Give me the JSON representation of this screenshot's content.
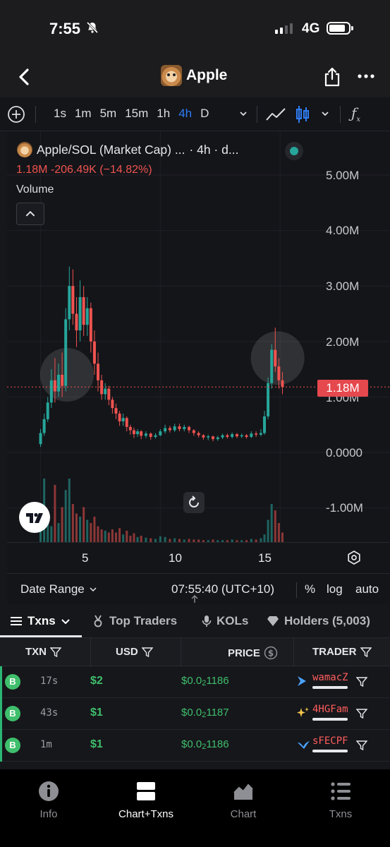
{
  "status": {
    "time": "7:55",
    "network": "4G"
  },
  "header": {
    "title": "Apple"
  },
  "toolbar": {
    "intervals": [
      "1s",
      "1m",
      "5m",
      "15m",
      "1h",
      "4h",
      "D"
    ],
    "active_interval": "4h"
  },
  "chart": {
    "symbol": "Apple/SOL (Market Cap) ...",
    "interval_text": "· 4h · d...",
    "change_text": "1.18M  -206.49K (−14.82%)",
    "volume_label": "Volume",
    "price_tag": "1.18M",
    "y_axis": [
      "5.00M",
      "4.00M",
      "3.00M",
      "2.00M",
      "1.00M",
      "0.0000",
      "-1.00M"
    ],
    "x_axis": [
      "5",
      "10",
      "15"
    ]
  },
  "range_bar": {
    "date_range": "Date Range",
    "clock": "07:55:40 (UTC+10)",
    "percent": "%",
    "log": "log",
    "auto": "auto"
  },
  "tabs": {
    "txns": "Txns",
    "top_traders": "Top Traders",
    "kols": "KOLs",
    "holders": "Holders (5,003)"
  },
  "table": {
    "headers": {
      "txn": "TXN",
      "usd": "USD",
      "price": "PRICE",
      "trader": "TRADER"
    },
    "rows": [
      {
        "type": "B",
        "age": "17s",
        "usd": "$2",
        "price_main": "$0.0",
        "price_sub": "2",
        "price_tail": "1186",
        "trader": "wamacZ"
      },
      {
        "type": "B",
        "age": "43s",
        "usd": "$1",
        "price_main": "$0.0",
        "price_sub": "2",
        "price_tail": "1187",
        "trader": "4HGFam"
      },
      {
        "type": "B",
        "age": "1m",
        "usd": "$1",
        "price_main": "$0.0",
        "price_sub": "2",
        "price_tail": "1186",
        "trader": "sFECPF"
      }
    ]
  },
  "bottom_nav": {
    "info": "Info",
    "chart_txns": "Chart+Txns",
    "chart": "Chart",
    "txns": "Txns"
  },
  "colors": {
    "up": "#26a69a",
    "down": "#ef5350",
    "accent": "#2f7df6",
    "buy_green": "#3fbf6c"
  },
  "chart_data": {
    "type": "candlestick",
    "x_range": [
      3.6,
      16.5
    ],
    "ylim": [
      -1500000,
      5500000
    ],
    "price_line": 1180000,
    "candles": [
      {
        "x": 5.0,
        "o": 150000,
        "c": 350000,
        "h": 420000,
        "l": 100000
      },
      {
        "x": 5.15,
        "o": 350000,
        "c": 600000,
        "h": 700000,
        "l": 300000
      },
      {
        "x": 5.3,
        "o": 600000,
        "c": 900000,
        "h": 1000000,
        "l": 550000
      },
      {
        "x": 5.45,
        "o": 900000,
        "c": 1300000,
        "h": 1500000,
        "l": 800000
      },
      {
        "x": 5.6,
        "o": 1300000,
        "c": 1100000,
        "h": 1700000,
        "l": 900000
      },
      {
        "x": 5.75,
        "o": 1100000,
        "c": 1400000,
        "h": 1600000,
        "l": 1000000
      },
      {
        "x": 5.9,
        "o": 1400000,
        "c": 1200000,
        "h": 1800000,
        "l": 1000000
      },
      {
        "x": 6.05,
        "o": 1200000,
        "c": 2400000,
        "h": 2600000,
        "l": 1100000
      },
      {
        "x": 6.2,
        "o": 2400000,
        "c": 3000000,
        "h": 3350000,
        "l": 2200000
      },
      {
        "x": 6.35,
        "o": 3000000,
        "c": 2500000,
        "h": 3300000,
        "l": 2300000
      },
      {
        "x": 6.5,
        "o": 2500000,
        "c": 2200000,
        "h": 2800000,
        "l": 1900000
      },
      {
        "x": 6.65,
        "o": 2200000,
        "c": 2800000,
        "h": 3100000,
        "l": 2000000
      },
      {
        "x": 6.8,
        "o": 2800000,
        "c": 2300000,
        "h": 3000000,
        "l": 2100000
      },
      {
        "x": 6.95,
        "o": 2300000,
        "c": 2600000,
        "h": 2800000,
        "l": 2100000
      },
      {
        "x": 7.1,
        "o": 2600000,
        "c": 2000000,
        "h": 2700000,
        "l": 1800000
      },
      {
        "x": 7.25,
        "o": 2000000,
        "c": 1600000,
        "h": 2200000,
        "l": 1400000
      },
      {
        "x": 7.4,
        "o": 1600000,
        "c": 1300000,
        "h": 1800000,
        "l": 1100000
      },
      {
        "x": 7.55,
        "o": 1300000,
        "c": 1050000,
        "h": 1400000,
        "l": 950000
      },
      {
        "x": 7.7,
        "o": 1050000,
        "c": 1150000,
        "h": 1250000,
        "l": 950000
      },
      {
        "x": 7.85,
        "o": 1150000,
        "c": 950000,
        "h": 1200000,
        "l": 850000
      },
      {
        "x": 8.0,
        "o": 950000,
        "c": 800000,
        "h": 1000000,
        "l": 700000
      },
      {
        "x": 8.15,
        "o": 800000,
        "c": 700000,
        "h": 880000,
        "l": 600000
      },
      {
        "x": 8.3,
        "o": 700000,
        "c": 560000,
        "h": 750000,
        "l": 480000
      },
      {
        "x": 8.45,
        "o": 560000,
        "c": 620000,
        "h": 700000,
        "l": 480000
      },
      {
        "x": 8.6,
        "o": 620000,
        "c": 460000,
        "h": 650000,
        "l": 380000
      },
      {
        "x": 8.75,
        "o": 460000,
        "c": 400000,
        "h": 500000,
        "l": 320000
      },
      {
        "x": 8.9,
        "o": 400000,
        "c": 330000,
        "h": 450000,
        "l": 260000
      },
      {
        "x": 9.05,
        "o": 330000,
        "c": 380000,
        "h": 420000,
        "l": 280000
      },
      {
        "x": 9.2,
        "o": 380000,
        "c": 300000,
        "h": 400000,
        "l": 240000
      },
      {
        "x": 9.4,
        "o": 300000,
        "c": 340000,
        "h": 380000,
        "l": 260000
      },
      {
        "x": 9.6,
        "o": 340000,
        "c": 280000,
        "h": 360000,
        "l": 230000
      },
      {
        "x": 9.8,
        "o": 280000,
        "c": 310000,
        "h": 350000,
        "l": 250000
      },
      {
        "x": 10.0,
        "o": 310000,
        "c": 380000,
        "h": 420000,
        "l": 290000
      },
      {
        "x": 10.2,
        "o": 380000,
        "c": 440000,
        "h": 500000,
        "l": 340000
      },
      {
        "x": 10.4,
        "o": 440000,
        "c": 400000,
        "h": 480000,
        "l": 360000
      },
      {
        "x": 10.6,
        "o": 400000,
        "c": 470000,
        "h": 520000,
        "l": 370000
      },
      {
        "x": 10.8,
        "o": 470000,
        "c": 420000,
        "h": 520000,
        "l": 380000
      },
      {
        "x": 11.0,
        "o": 420000,
        "c": 460000,
        "h": 500000,
        "l": 380000
      },
      {
        "x": 11.2,
        "o": 460000,
        "c": 400000,
        "h": 480000,
        "l": 350000
      },
      {
        "x": 11.4,
        "o": 400000,
        "c": 350000,
        "h": 420000,
        "l": 300000
      },
      {
        "x": 11.6,
        "o": 350000,
        "c": 310000,
        "h": 380000,
        "l": 270000
      },
      {
        "x": 11.8,
        "o": 310000,
        "c": 270000,
        "h": 330000,
        "l": 230000
      },
      {
        "x": 12.0,
        "o": 270000,
        "c": 290000,
        "h": 320000,
        "l": 220000
      },
      {
        "x": 12.2,
        "o": 290000,
        "c": 240000,
        "h": 300000,
        "l": 200000
      },
      {
        "x": 12.4,
        "o": 240000,
        "c": 270000,
        "h": 300000,
        "l": 210000
      },
      {
        "x": 12.6,
        "o": 270000,
        "c": 310000,
        "h": 340000,
        "l": 240000
      },
      {
        "x": 12.8,
        "o": 310000,
        "c": 280000,
        "h": 340000,
        "l": 250000
      },
      {
        "x": 13.0,
        "o": 280000,
        "c": 330000,
        "h": 360000,
        "l": 250000
      },
      {
        "x": 13.2,
        "o": 330000,
        "c": 290000,
        "h": 350000,
        "l": 260000
      },
      {
        "x": 13.4,
        "o": 290000,
        "c": 310000,
        "h": 340000,
        "l": 260000
      },
      {
        "x": 13.6,
        "o": 310000,
        "c": 280000,
        "h": 330000,
        "l": 250000
      },
      {
        "x": 13.8,
        "o": 280000,
        "c": 340000,
        "h": 380000,
        "l": 260000
      },
      {
        "x": 14.0,
        "o": 340000,
        "c": 320000,
        "h": 380000,
        "l": 280000
      },
      {
        "x": 14.2,
        "o": 320000,
        "c": 350000,
        "h": 420000,
        "l": 290000
      },
      {
        "x": 14.35,
        "o": 350000,
        "c": 650000,
        "h": 750000,
        "l": 320000
      },
      {
        "x": 14.5,
        "o": 650000,
        "c": 1250000,
        "h": 1350000,
        "l": 600000
      },
      {
        "x": 14.65,
        "o": 1250000,
        "c": 1850000,
        "h": 1950000,
        "l": 1150000
      },
      {
        "x": 14.8,
        "o": 1850000,
        "c": 1550000,
        "h": 2250000,
        "l": 1450000
      },
      {
        "x": 14.95,
        "o": 1550000,
        "c": 1300000,
        "h": 1700000,
        "l": 1150000
      },
      {
        "x": 15.1,
        "o": 1300000,
        "c": 1180000,
        "h": 1450000,
        "l": 1050000
      }
    ],
    "volume": [
      {
        "x": 5.0,
        "v": 0.35,
        "up": true
      },
      {
        "x": 5.15,
        "v": 1.0,
        "up": true
      },
      {
        "x": 5.3,
        "v": 0.45,
        "up": true
      },
      {
        "x": 5.45,
        "v": 0.25,
        "up": true
      },
      {
        "x": 5.6,
        "v": 0.9,
        "up": false
      },
      {
        "x": 5.75,
        "v": 0.3,
        "up": true
      },
      {
        "x": 5.9,
        "v": 0.55,
        "up": false
      },
      {
        "x": 6.05,
        "v": 0.82,
        "up": true
      },
      {
        "x": 6.2,
        "v": 1.65,
        "up": true
      },
      {
        "x": 6.35,
        "v": 0.6,
        "up": false
      },
      {
        "x": 6.5,
        "v": 0.45,
        "up": false
      },
      {
        "x": 6.65,
        "v": 0.4,
        "up": true
      },
      {
        "x": 6.8,
        "v": 0.55,
        "up": false
      },
      {
        "x": 6.95,
        "v": 0.35,
        "up": true
      },
      {
        "x": 7.1,
        "v": 0.3,
        "up": false
      },
      {
        "x": 7.25,
        "v": 0.4,
        "up": false
      },
      {
        "x": 7.4,
        "v": 0.25,
        "up": false
      },
      {
        "x": 7.55,
        "v": 0.2,
        "up": false
      },
      {
        "x": 7.7,
        "v": 0.18,
        "up": true
      },
      {
        "x": 7.85,
        "v": 0.15,
        "up": false
      },
      {
        "x": 8.0,
        "v": 0.2,
        "up": false
      },
      {
        "x": 8.15,
        "v": 0.15,
        "up": false
      },
      {
        "x": 8.3,
        "v": 0.22,
        "up": false
      },
      {
        "x": 8.45,
        "v": 0.12,
        "up": true
      },
      {
        "x": 8.6,
        "v": 0.18,
        "up": false
      },
      {
        "x": 8.75,
        "v": 0.1,
        "up": false
      },
      {
        "x": 8.9,
        "v": 0.14,
        "up": false
      },
      {
        "x": 9.05,
        "v": 0.08,
        "up": true
      },
      {
        "x": 9.2,
        "v": 0.1,
        "up": false
      },
      {
        "x": 9.4,
        "v": 0.07,
        "up": true
      },
      {
        "x": 9.6,
        "v": 0.06,
        "up": false
      },
      {
        "x": 9.8,
        "v": 0.05,
        "up": true
      },
      {
        "x": 10.0,
        "v": 0.09,
        "up": true
      },
      {
        "x": 10.2,
        "v": 0.08,
        "up": true
      },
      {
        "x": 10.4,
        "v": 0.05,
        "up": false
      },
      {
        "x": 10.6,
        "v": 0.06,
        "up": true
      },
      {
        "x": 10.8,
        "v": 0.05,
        "up": false
      },
      {
        "x": 11.0,
        "v": 0.04,
        "up": true
      },
      {
        "x": 11.2,
        "v": 0.05,
        "up": false
      },
      {
        "x": 11.4,
        "v": 0.04,
        "up": false
      },
      {
        "x": 11.6,
        "v": 0.04,
        "up": false
      },
      {
        "x": 11.8,
        "v": 0.03,
        "up": false
      },
      {
        "x": 12.0,
        "v": 0.03,
        "up": true
      },
      {
        "x": 12.2,
        "v": 0.04,
        "up": false
      },
      {
        "x": 12.4,
        "v": 0.03,
        "up": true
      },
      {
        "x": 12.6,
        "v": 0.03,
        "up": true
      },
      {
        "x": 12.8,
        "v": 0.03,
        "up": false
      },
      {
        "x": 13.0,
        "v": 0.04,
        "up": true
      },
      {
        "x": 13.2,
        "v": 0.03,
        "up": false
      },
      {
        "x": 13.4,
        "v": 0.03,
        "up": true
      },
      {
        "x": 13.6,
        "v": 0.03,
        "up": false
      },
      {
        "x": 13.8,
        "v": 0.05,
        "up": true
      },
      {
        "x": 14.0,
        "v": 0.04,
        "up": false
      },
      {
        "x": 14.2,
        "v": 0.06,
        "up": true
      },
      {
        "x": 14.35,
        "v": 0.12,
        "up": true
      },
      {
        "x": 14.5,
        "v": 0.35,
        "up": true
      },
      {
        "x": 14.65,
        "v": 0.6,
        "up": true
      },
      {
        "x": 14.8,
        "v": 0.5,
        "up": false
      },
      {
        "x": 14.95,
        "v": 0.3,
        "up": false
      },
      {
        "x": 15.1,
        "v": 0.15,
        "up": false
      }
    ]
  }
}
